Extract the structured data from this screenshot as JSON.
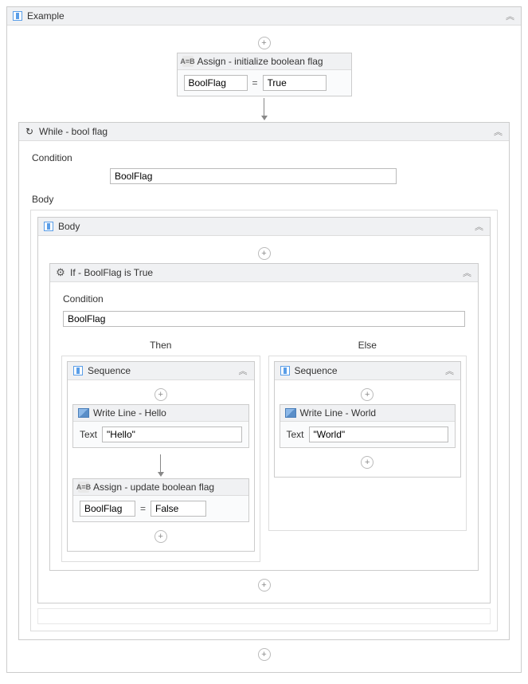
{
  "root": {
    "title": "Example"
  },
  "assign1": {
    "title": "Assign - initialize boolean flag",
    "left": "BoolFlag",
    "right": "True",
    "eq": "="
  },
  "while": {
    "title": "While - bool flag",
    "condLabel": "Condition",
    "condValue": "BoolFlag",
    "bodyLabel": "Body"
  },
  "bodySeq": {
    "title": "Body"
  },
  "ifAct": {
    "title": "If - BoolFlag is True",
    "condLabel": "Condition",
    "condValue": "BoolFlag",
    "thenLabel": "Then",
    "elseLabel": "Else"
  },
  "thenSeq": {
    "title": "Sequence"
  },
  "elseSeq": {
    "title": "Sequence"
  },
  "write1": {
    "title": "Write Line - Hello",
    "label": "Text",
    "value": "\"Hello\""
  },
  "write2": {
    "title": "Write Line - World",
    "label": "Text",
    "value": "\"World\""
  },
  "assign2": {
    "title": "Assign - update boolean flag",
    "left": "BoolFlag",
    "right": "False",
    "eq": "="
  },
  "icons": {
    "ab": "A=B"
  }
}
